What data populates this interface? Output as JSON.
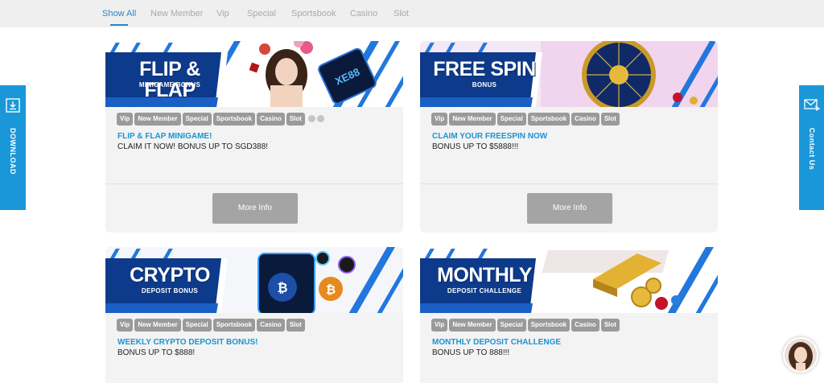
{
  "tabs": [
    {
      "label": "Show All",
      "active": true
    },
    {
      "label": "New Member",
      "active": false
    },
    {
      "label": "Vip",
      "active": false
    },
    {
      "label": "Special",
      "active": false
    },
    {
      "label": "Sportsbook",
      "active": false
    },
    {
      "label": "Casino",
      "active": false
    },
    {
      "label": "Slot",
      "active": false
    }
  ],
  "side": {
    "download_label": "DOWNLOAD",
    "download_icon": "download-icon",
    "contact_label": "Contact Us",
    "contact_icon": "mail-icon"
  },
  "colors": {
    "accent": "#2a85c7",
    "side_tab": "#1a97d8",
    "banner_navy": "#0d3a8a",
    "promo_title": "#1a94d3",
    "tag_bg": "#9a9a9a",
    "button_bg": "#a4a4a4"
  },
  "cards": [
    {
      "banner_title": "FLIP & FLAP",
      "banner_sub": "MINIGAME BONUS",
      "banner_art": "character-with-phone",
      "tags": [
        "Vip",
        "New Member",
        "Special",
        "Sportsbook",
        "Casino",
        "Slot"
      ],
      "title": "FLIP & FLAP MINIGAME!",
      "description": "CLAIM IT NOW! BONUS UP TO SGD388!",
      "button": "More Info"
    },
    {
      "banner_title": "FREE SPIN",
      "banner_sub": "BONUS",
      "banner_art": "prize-wheel",
      "tags": [
        "Vip",
        "New Member",
        "Special",
        "Sportsbook",
        "Casino",
        "Slot"
      ],
      "title": "CLAIM YOUR FREESPIN NOW",
      "description": "BONUS UP TO $5888!!!",
      "button": "More Info"
    },
    {
      "banner_title": "CRYPTO",
      "banner_sub": "DEPOSIT BONUS",
      "banner_art": "crypto-phone",
      "tags": [
        "Vip",
        "New Member",
        "Special",
        "Sportsbook",
        "Casino",
        "Slot"
      ],
      "title": "WEEKLY CRYPTO DEPOSIT BONUS!",
      "description": "BONUS UP TO $888!"
    },
    {
      "banner_title": "MONTHLY",
      "banner_sub": "DEPOSIT CHALLENGE",
      "banner_art": "gold-bars",
      "tags": [
        "Vip",
        "New Member",
        "Special",
        "Sportsbook",
        "Casino",
        "Slot"
      ],
      "title": "MONTHLY DEPOSIT CHALLENGE",
      "description": "BONUS UP TO 888!!!"
    }
  ],
  "chat": {
    "icon": "chat-avatar-icon"
  }
}
